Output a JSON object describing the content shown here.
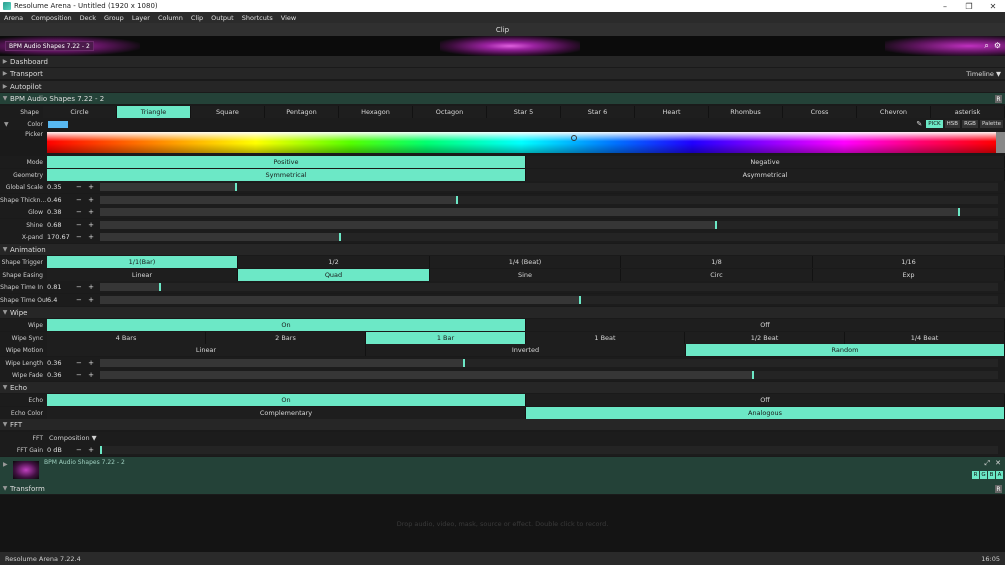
{
  "window": {
    "title": "Resolume Arena - Untitled (1920 x 1080)",
    "controls": [
      "–",
      "❐",
      "✕"
    ]
  },
  "menu": [
    "Arena",
    "Composition",
    "Deck",
    "Group",
    "Layer",
    "Column",
    "Clip",
    "Output",
    "Shortcuts",
    "View"
  ],
  "panel": {
    "title": "Clip",
    "clip_name": "BPM Audio Shapes 7.22 - 2"
  },
  "sections": {
    "dashboard": "Dashboard",
    "transport": "Transport",
    "transport_mode": "Timeline",
    "autopilot": "Autopilot",
    "effect": "BPM Audio Shapes 7.22 - 2",
    "animation": "Animation",
    "wipe": "Wipe",
    "echo": "Echo",
    "fft": "FFT",
    "transform": "Transform"
  },
  "shape": {
    "label": "Shape",
    "options": [
      "Circle",
      "Triangle",
      "Square",
      "Pentagon",
      "Hexagon",
      "Octagon",
      "Star 5",
      "Star 6",
      "Heart",
      "Rhombus",
      "Cross",
      "Chevron",
      "asterisk"
    ],
    "selected": "Triangle"
  },
  "color": {
    "label": "Color",
    "swatch": "#58b8f0",
    "modes": [
      "PICK",
      "HSB",
      "RGB",
      "Palette"
    ],
    "active_mode": "PICK",
    "picker_label": "Picker"
  },
  "mode": {
    "label": "Mode",
    "options": [
      "Positive",
      "Negative"
    ],
    "selected": "Positive"
  },
  "geometry": {
    "label": "Geometry",
    "options": [
      "Symmetrical",
      "Asymmetrical"
    ],
    "selected": "Symmetrical"
  },
  "params": {
    "global_scale": {
      "label": "Global Scale",
      "value": "0.35",
      "level": 0.152
    },
    "shape_thickness": {
      "label": "Shape Thickn...",
      "value": "0.46",
      "level": 0.398
    },
    "glow": {
      "label": "Glow",
      "value": "0.38",
      "level": 0.957
    },
    "shine": {
      "label": "Shine",
      "value": "0.68",
      "level": 0.686
    },
    "xpand": {
      "label": "X-pand",
      "value": "170.67",
      "level": 0.267
    },
    "shape_time_in": {
      "label": "Shape Time In",
      "value": "0.81",
      "level": 0.067
    },
    "shape_time_out": {
      "label": "Shape Time Out",
      "value": "6.4",
      "level": 0.535
    },
    "wipe_length": {
      "label": "Wipe Length",
      "value": "0.36",
      "level": 0.405
    },
    "wipe_fade": {
      "label": "Wipe Fade",
      "value": "0.36",
      "level": 0.727
    },
    "fft_gain": {
      "label": "FFT Gain",
      "value": "0 dB",
      "level": 0.0
    }
  },
  "shape_trigger": {
    "label": "Shape Trigger",
    "options": [
      "1/1(Bar)",
      "1/2",
      "1/4 (Beat)",
      "1/8",
      "1/16"
    ],
    "selected": "1/1(Bar)"
  },
  "shape_easing": {
    "label": "Shape Easing",
    "options": [
      "Linear",
      "Quad",
      "Sine",
      "Circ",
      "Exp"
    ],
    "selected": "Quad"
  },
  "wipe": {
    "label": "Wipe",
    "options": [
      "On",
      "Off"
    ],
    "selected": "On"
  },
  "wipe_sync": {
    "label": "Wipe Sync",
    "options": [
      "4 Bars",
      "2 Bars",
      "1 Bar",
      "1 Beat",
      "1/2 Beat",
      "1/4 Beat"
    ],
    "selected": "1 Bar"
  },
  "wipe_motion": {
    "label": "Wipe Motion",
    "options": [
      "Linear",
      "Inverted",
      "Random"
    ],
    "selected": "Random"
  },
  "echo": {
    "label": "Echo",
    "options": [
      "On",
      "Off"
    ],
    "selected": "On"
  },
  "echo_color": {
    "label": "Echo Color",
    "options": [
      "Complementary",
      "Analogous"
    ],
    "selected": "Analogous"
  },
  "fft": {
    "label": "FFT",
    "value": "Composition"
  },
  "source": {
    "name": "BPM Audio Shapes 7.22 - 2",
    "rgba": [
      "R",
      "G",
      "B",
      "A"
    ]
  },
  "dropzone": "Drop audio, video, mask, source or effect. Double click to record.",
  "status": {
    "version": "Resolume Arena 7.22.4",
    "time": "16:05"
  },
  "accent": "#6ce8c6"
}
